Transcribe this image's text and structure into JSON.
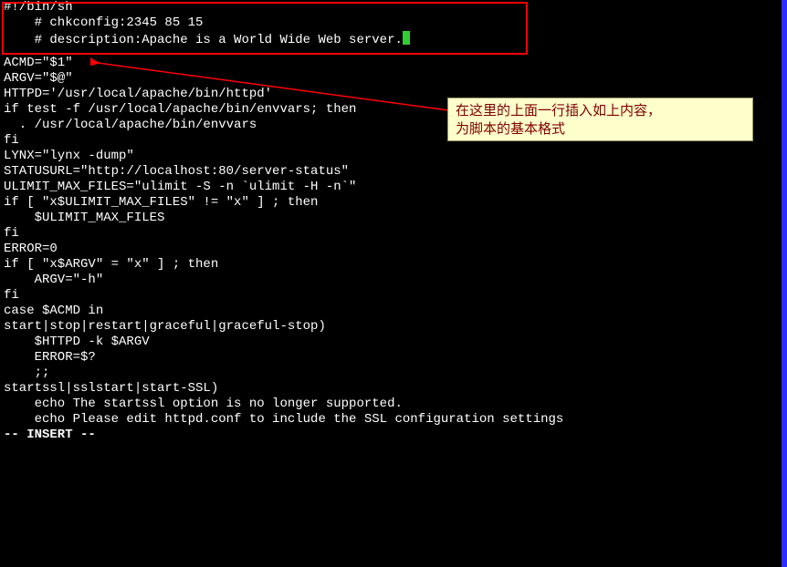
{
  "header": {
    "l1": "#!/bin/sh",
    "l2": "    # chkconfig:2345 85 15",
    "l3": "    # description:Apache is a World Wide Web server."
  },
  "code": {
    "l4": "ACMD=\"$1\"",
    "l5": "ARGV=\"$@\"",
    "l6": "HTTPD='/usr/local/apache/bin/httpd'",
    "l7": "if test -f /usr/local/apache/bin/envvars; then",
    "l8": "  . /usr/local/apache/bin/envvars",
    "l9": "fi",
    "l10": "LYNX=\"lynx -dump\"",
    "l11": "STATUSURL=\"http://localhost:80/server-status\"",
    "l12": "ULIMIT_MAX_FILES=\"ulimit -S -n `ulimit -H -n`\"",
    "l13": "",
    "l14": "if [ \"x$ULIMIT_MAX_FILES\" != \"x\" ] ; then",
    "l15": "    $ULIMIT_MAX_FILES",
    "l16": "fi",
    "l17": "",
    "l18": "ERROR=0",
    "l19": "if [ \"x$ARGV\" = \"x\" ] ; then",
    "l20": "    ARGV=\"-h\"",
    "l21": "fi",
    "l22": "",
    "l23": "case $ACMD in",
    "l24": "start|stop|restart|graceful|graceful-stop)",
    "l25": "    $HTTPD -k $ARGV",
    "l26": "    ERROR=$?",
    "l27": "    ;;",
    "l28": "startssl|sslstart|start-SSL)",
    "l29": "    echo The startssl option is no longer supported.",
    "l30": "    echo Please edit httpd.conf to include the SSL configuration settings"
  },
  "status": "-- INSERT --",
  "callout": {
    "line1": "在这里的上面一行插入如上内容，",
    "line2": "为脚本的基本格式"
  }
}
